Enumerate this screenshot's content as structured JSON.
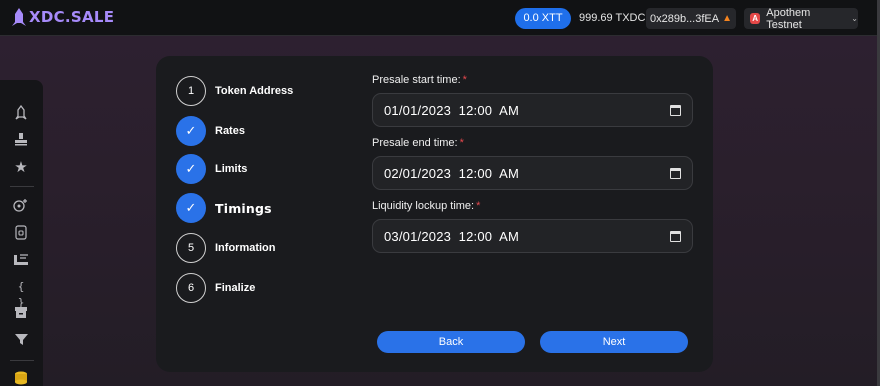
{
  "app": {
    "logo_text": "XDC.SALE"
  },
  "header": {
    "balance_pill": "0.0 XTT",
    "native_balance": "999.69 TXDC",
    "wallet_address": "0x289b...3fEA",
    "network_badge": "A",
    "network_name": "Apothem Testnet"
  },
  "sidebar": {
    "icons": [
      "rocket-icon",
      "stamp-icon",
      "star-icon",
      "coin-plus-icon",
      "lock-icon",
      "staking-icon",
      "code-icon",
      "box-icon",
      "filter-icon",
      "coins-icon"
    ]
  },
  "steps": [
    {
      "marker": "1",
      "label": "Token Address",
      "state": "pending"
    },
    {
      "marker": "✓",
      "label": "Rates",
      "state": "done"
    },
    {
      "marker": "✓",
      "label": "Limits",
      "state": "done"
    },
    {
      "marker": "✓",
      "label": "Timings",
      "state": "current"
    },
    {
      "marker": "5",
      "label": "Information",
      "state": "pending"
    },
    {
      "marker": "6",
      "label": "Finalize",
      "state": "pending"
    }
  ],
  "form": {
    "presale_start": {
      "label": "Presale start time:",
      "required_mark": "*",
      "value": "01/01/2023  12:00  AM"
    },
    "presale_end": {
      "label": "Presale end time:",
      "required_mark": "*",
      "value": "02/01/2023  12:00  AM"
    },
    "liquidity_lockup": {
      "label": "Liquidity lockup time:",
      "required_mark": "*",
      "value": "03/01/2023  12:00  AM"
    }
  },
  "buttons": {
    "back": "Back",
    "next": "Next"
  },
  "colors": {
    "accent": "#2a72e8",
    "required": "#e5484d",
    "logo": "#a78bfa"
  }
}
